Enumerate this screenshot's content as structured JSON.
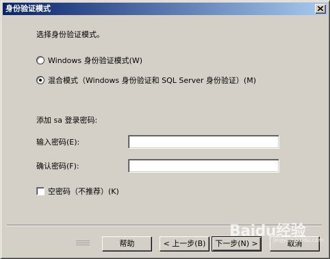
{
  "window": {
    "title": "身份验证模式"
  },
  "prompt": "选择身份验证模式。",
  "auth_modes": [
    {
      "label": "Windows 身份验证模式(W)",
      "selected": false
    },
    {
      "label": "混合模式（Windows 身份验证和 SQL Server 身份验证）(M)",
      "selected": true
    }
  ],
  "sa_section": {
    "label": "添加 sa 登录密码:",
    "password_label": "输入密码(E):",
    "password_value": "",
    "confirm_label": "确认密码(F):",
    "confirm_value": ""
  },
  "blank_password": {
    "label": "空密码（不推荐）(K)",
    "checked": false
  },
  "buttons": {
    "help": "帮助",
    "back": "< 上一步(B)",
    "next": "下一步(N) >",
    "cancel": "取消"
  },
  "watermark": {
    "main": "Baidu经验",
    "sub": "jingyan.baidu.com"
  },
  "colors": {
    "face": "#d4d0c8",
    "title_start": "#0a246a",
    "title_end": "#a6caf0"
  }
}
